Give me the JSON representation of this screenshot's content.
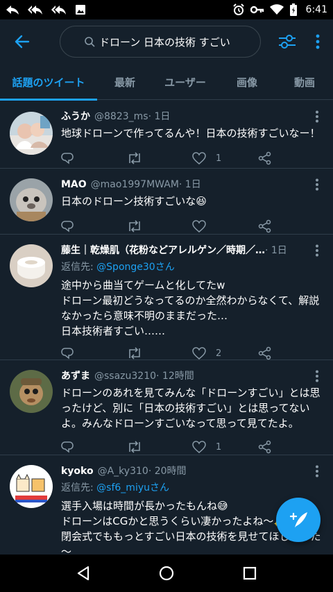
{
  "status_bar": {
    "time": "6:41",
    "left_icons": [
      "reply-icon",
      "reply-all-icon",
      "reply-all-icon",
      "image-icon"
    ],
    "right_icons": [
      "alarm-icon",
      "key-icon",
      "wifi-icon",
      "battery-icon"
    ]
  },
  "header": {
    "search_query": "ドローン 日本の技術 すごい"
  },
  "tabs": [
    {
      "label": "話題のツイート",
      "active": true
    },
    {
      "label": "最新",
      "active": false
    },
    {
      "label": "ユーザー",
      "active": false
    },
    {
      "label": "画像",
      "active": false
    },
    {
      "label": "動画",
      "active": false
    }
  ],
  "tweets": [
    {
      "name": "ふうか",
      "handle": "@8823_ms",
      "time": " · 1日",
      "reply_prefix": "",
      "reply_mention": "",
      "lines": [
        "地球ドローンで作ってるんや！日本の技術すごいなー！"
      ],
      "reply_count": "",
      "retweet_count": "",
      "like_count": "1"
    },
    {
      "name": "MAO",
      "handle": "@mao1997MWAM",
      "time": " · 1日",
      "reply_prefix": "",
      "reply_mention": "",
      "lines": [
        "日本のドローン技術すごいな😆"
      ],
      "reply_count": "",
      "retweet_count": "",
      "like_count": ""
    },
    {
      "name": "藤生｜乾燥肌（花粉などアレルゲン／時期／…",
      "handle": "",
      "time": " · 1日",
      "reply_prefix": "返信先: ",
      "reply_mention": "@Sponge30さん",
      "lines": [
        "途中から曲当てゲームと化してたw",
        "ドローン最初どうなってるのか全然わからなくて、解説",
        "なかったら意味不明のままだった…",
        "日本技術者すごい……"
      ],
      "reply_count": "",
      "retweet_count": "",
      "like_count": "2"
    },
    {
      "name": "あずま",
      "handle": "@ssazu3210",
      "time": " · 12時間",
      "reply_prefix": "",
      "reply_mention": "",
      "lines": [
        "ドローンのあれを見てみんな「ドローンすごい」とは思",
        "ったけど、別に「日本の技術すごい」とは思ってない",
        "よ。みんなドローンすごいなって思って見てたよ。"
      ],
      "reply_count": "",
      "retweet_count": "",
      "like_count": "1"
    },
    {
      "name": "kyoko",
      "handle": "@A_ky310",
      "time": " · 20時間",
      "reply_prefix": "返信先: ",
      "reply_mention": "@sf6_miyuさん",
      "lines": [
        "選手入場は時間が長かったもんね😅",
        "ドローンはCGかと思うくらい凄かったよね～✨",
        "閉会式でももっとすごい日本の技術を見せてほしかった",
        "～"
      ],
      "reply_count": "",
      "retweet_count": "",
      "like_count": ""
    }
  ],
  "colors": {
    "background": "#15202b",
    "accent": "#1da1f2",
    "secondary_text": "#8899a6",
    "divider": "#2f3d4a"
  }
}
